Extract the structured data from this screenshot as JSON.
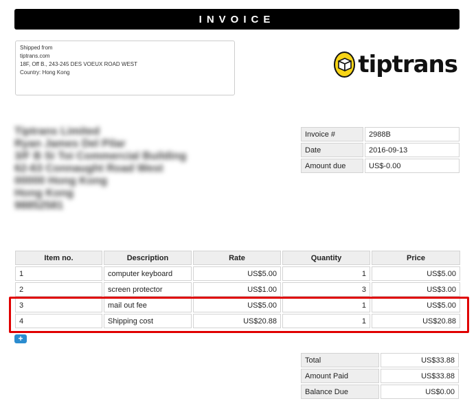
{
  "header": {
    "title": "INVOICE"
  },
  "ship_from": {
    "lines": [
      "Shipped from",
      "tiptrans.com",
      "18F, Off B., 243-245 DES VOEUX ROAD WEST",
      "Country: Hong Kong"
    ]
  },
  "logo": {
    "text": "tiptrans"
  },
  "address": {
    "lines": [
      "Tiptrans Limited",
      "Ryan James Del Pilar",
      "3/F B Si Toi Commercial Building",
      "62-63 Connaught Road West",
      "00000 Hong Kong",
      "Hong Kong",
      "98852581"
    ]
  },
  "meta": [
    {
      "label": "Invoice #",
      "value": "2988B"
    },
    {
      "label": "Date",
      "value": "2016-09-13"
    },
    {
      "label": "Amount due",
      "value": "US$-0.00"
    }
  ],
  "items": {
    "headers": [
      "Item no.",
      "Description",
      "Rate",
      "Quantity",
      "Price"
    ],
    "rows": [
      {
        "no": "1",
        "description": "computer keyboard",
        "rate": "US$5.00",
        "quantity": "1",
        "price": "US$5.00"
      },
      {
        "no": "2",
        "description": "screen protector",
        "rate": "US$1.00",
        "quantity": "3",
        "price": "US$3.00"
      },
      {
        "no": "3",
        "description": "mail out fee",
        "rate": "US$5.00",
        "quantity": "1",
        "price": "US$5.00"
      },
      {
        "no": "4",
        "description": "Shipping cost",
        "rate": "US$20.88",
        "quantity": "1",
        "price": "US$20.88"
      }
    ],
    "add_label": "+"
  },
  "totals": [
    {
      "label": "Total",
      "value": "US$33.88"
    },
    {
      "label": "Amount Paid",
      "value": "US$33.88"
    },
    {
      "label": "Balance Due",
      "value": "US$0.00"
    }
  ],
  "colors": {
    "highlight": "#e00000",
    "logo_yellow": "#f7d417",
    "add_button": "#2b8ccf"
  }
}
